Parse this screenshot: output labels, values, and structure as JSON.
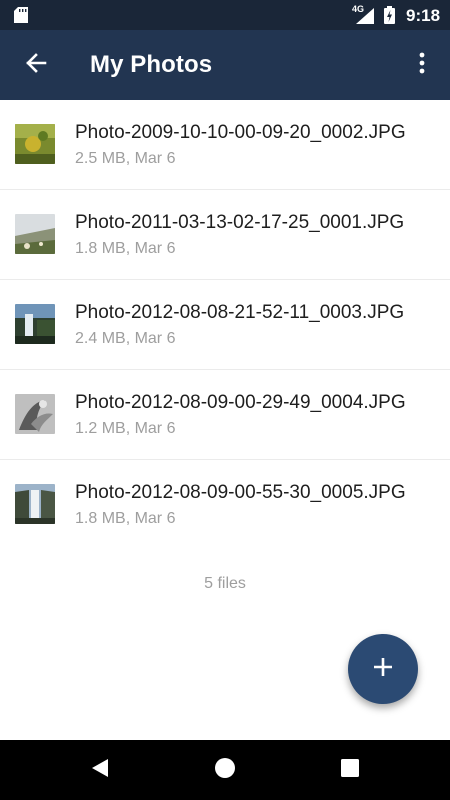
{
  "status_bar": {
    "network": "4G",
    "time": "9:18",
    "icons": [
      "sd-card-icon",
      "signal-icon",
      "battery-charging-icon"
    ]
  },
  "app_bar": {
    "title": "My Photos",
    "back_icon": "arrow-left-icon",
    "more_icon": "more-vert-icon"
  },
  "files": [
    {
      "name": "Photo-2009-10-10-00-09-20_0002.JPG",
      "meta": "2.5 MB, Mar 6"
    },
    {
      "name": "Photo-2011-03-13-02-17-25_0001.JPG",
      "meta": "1.8 MB, Mar 6"
    },
    {
      "name": "Photo-2012-08-08-21-52-11_0003.JPG",
      "meta": "2.4 MB, Mar 6"
    },
    {
      "name": "Photo-2012-08-09-00-29-49_0004.JPG",
      "meta": "1.2 MB, Mar 6"
    },
    {
      "name": "Photo-2012-08-09-00-55-30_0005.JPG",
      "meta": "1.8 MB, Mar 6"
    }
  ],
  "file_count": "5 files",
  "fab_icon": "plus-icon",
  "colors": {
    "status_bar": "#1a2638",
    "app_bar": "#223551",
    "fab": "#2b4a73",
    "secondary_text": "#9e9e9e"
  }
}
